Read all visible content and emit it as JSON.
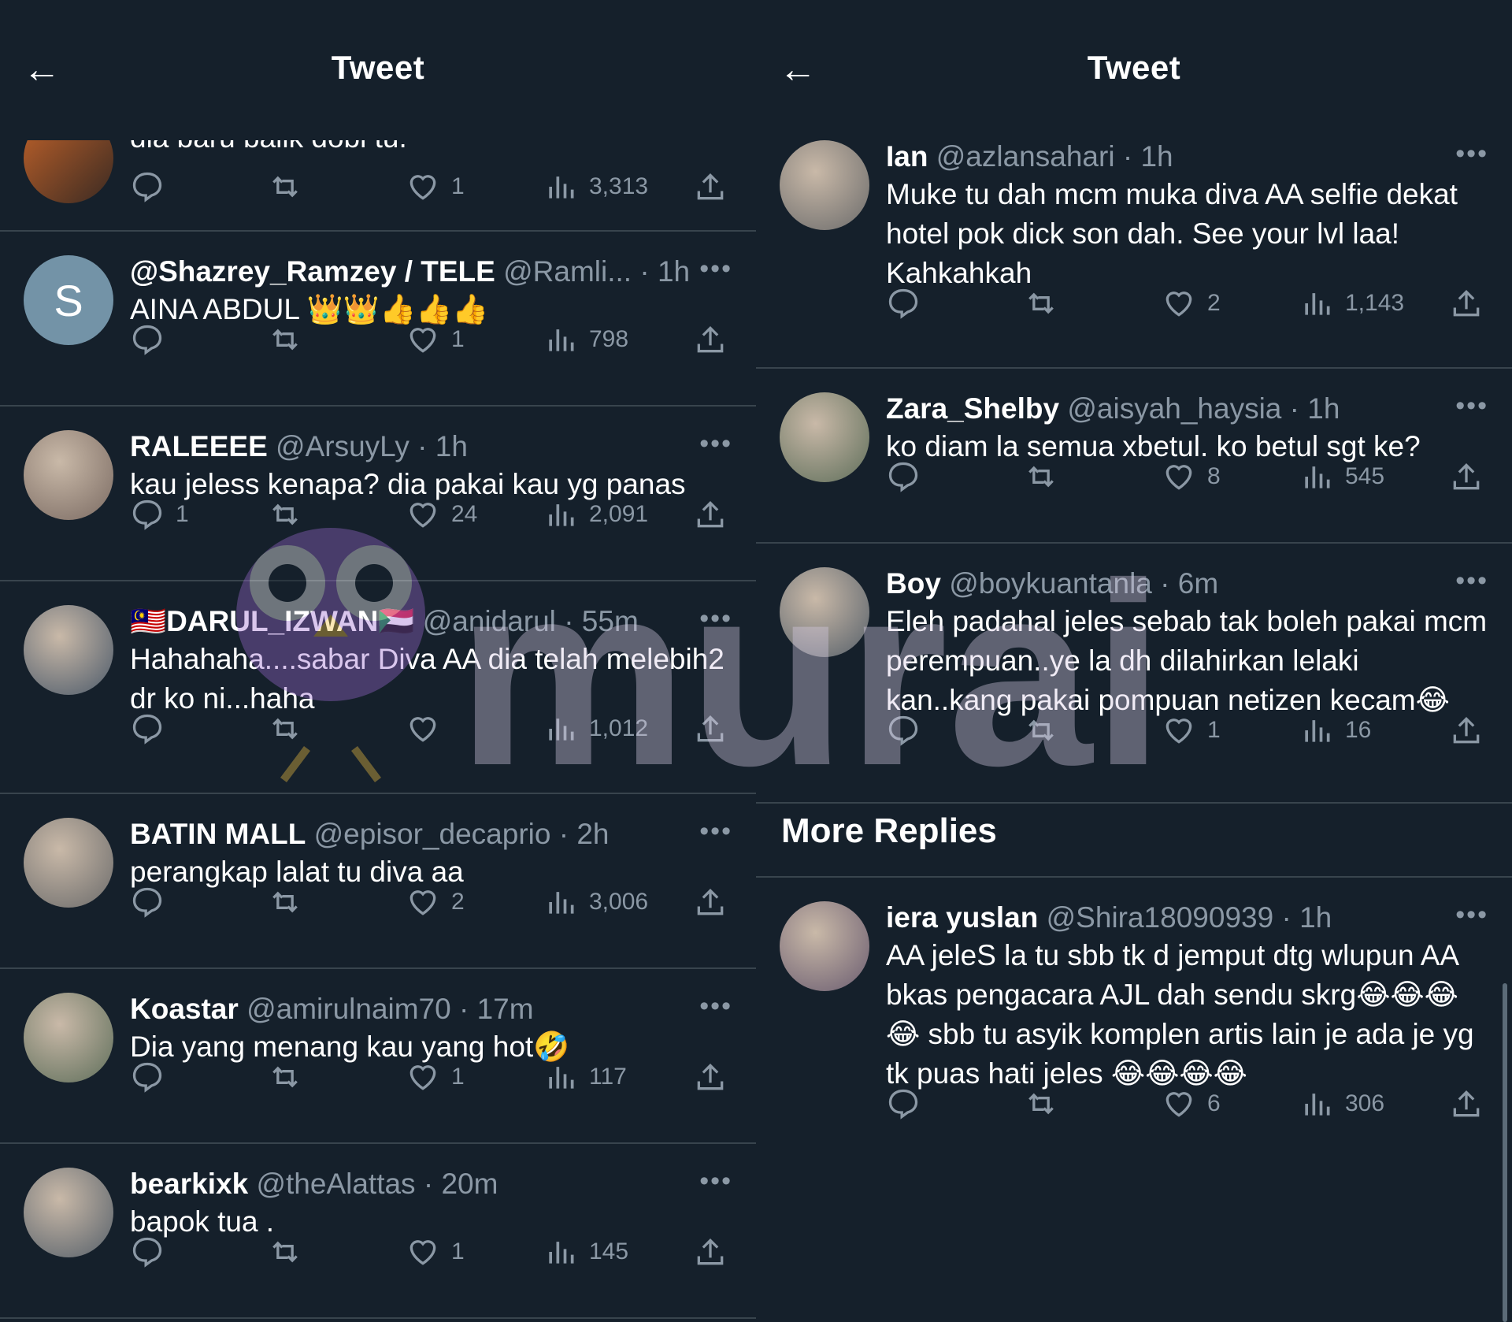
{
  "left": {
    "title": "Tweet",
    "first_reply": {
      "text": "dia baru balik dobi tu.",
      "reply_count": "",
      "likes": "1",
      "views": "3,313"
    },
    "replies": [
      {
        "name": "@Shazrey_Ramzey / TELE",
        "handle": "@Ramli...",
        "time": "1h",
        "text": "AINA ABDUL 👑👑👍👍👍",
        "reply_count": "",
        "likes": "1",
        "views": "798",
        "avatar": "S"
      },
      {
        "name": "RALEEEE",
        "handle": "@ArsuyLy",
        "time": "1h",
        "text": "kau jeless kenapa? dia pakai kau yg panas",
        "reply_count": "1",
        "likes": "24",
        "views": "2,091"
      },
      {
        "name": "🇲🇾DARUL_IZWAN🇸🇩",
        "handle": "@anidarul",
        "time": "55m",
        "text": "Hahahaha....sabar Diva AA dia telah melebih2 dr ko ni...haha",
        "reply_count": "",
        "likes": "",
        "views": "1,012"
      },
      {
        "name": "BATIN MALL",
        "handle": "@episor_decaprio",
        "time": "2h",
        "text": "perangkap lalat tu diva aa",
        "reply_count": "",
        "likes": "2",
        "views": "3,006"
      },
      {
        "name": "Koastar",
        "handle": "@amirulnaim70",
        "time": "17m",
        "text": "Dia yang menang kau yang hot🤣",
        "reply_count": "",
        "likes": "1",
        "views": "117"
      },
      {
        "name": "bearkixk",
        "handle": "@theAlattas",
        "time": "20m",
        "text": "bapok tua .",
        "reply_count": "",
        "likes": "1",
        "views": "145"
      }
    ]
  },
  "right": {
    "title": "Tweet",
    "replies": [
      {
        "name": "Ian",
        "handle": "@azlansahari",
        "time": "1h",
        "text": "Muke tu dah mcm muka diva AA selfie dekat hotel pok dick son dah. See your lvl laa! Kahkahkah",
        "reply_count": "",
        "likes": "2",
        "views": "1,143"
      },
      {
        "name": "Zara_Shelby",
        "handle": "@aisyah_haysia",
        "time": "1h",
        "text": "ko diam la semua xbetul. ko betul sgt ke?",
        "reply_count": "",
        "likes": "8",
        "views": "545"
      },
      {
        "name": "Boy",
        "handle": "@boykuantanla",
        "time": "6m",
        "text": "Eleh padahal jeles sebab tak boleh pakai mcm perempuan..ye la dh dilahirkan lelaki kan..kang pakai pompuan netizen kecam😂",
        "reply_count": "",
        "likes": "1",
        "views": "16"
      }
    ],
    "section_title": "More Replies",
    "more_replies": [
      {
        "name": "iera yuslan",
        "handle": "@Shira18090939",
        "time": "1h",
        "text": "AA jeleS la tu sbb tk d jemput dtg wlupun AA bkas pengacara AJL dah sendu skrg😂😂😂😂 sbb tu asyik komplen artis lain je ada je yg tk puas hati jeles 😂😂😂😂",
        "reply_count": "",
        "likes": "6",
        "views": "306"
      }
    ]
  },
  "watermark": {
    "text": "murai"
  },
  "colors": {
    "bg": "#15202b",
    "muted": "#8b98a5",
    "divider": "#38444d"
  }
}
